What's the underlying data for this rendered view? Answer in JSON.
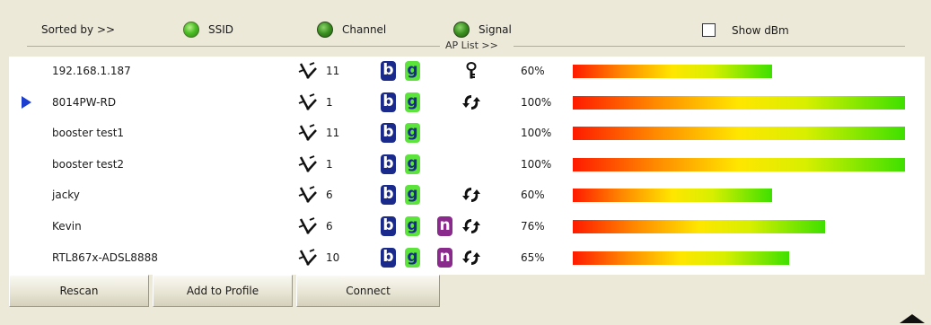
{
  "sortbar": {
    "sorted_by": "Sorted by >>",
    "ssid": "SSID",
    "channel": "Channel",
    "signal": "Signal",
    "show_dbm": "Show dBm",
    "ap_list": "AP List >>"
  },
  "rows": [
    {
      "ssid": "192.168.1.187",
      "channel": "11",
      "b": "b",
      "g": "g",
      "n": "",
      "security": "key-icon",
      "signal": "60%",
      "signal_value": 0.6
    },
    {
      "ssid": "8014PW-RD",
      "channel": "1",
      "b": "b",
      "g": "g",
      "n": "",
      "security": "wps-icon",
      "signal": "100%",
      "signal_value": 1.0,
      "selected": true
    },
    {
      "ssid": "booster test1",
      "channel": "11",
      "b": "b",
      "g": "g",
      "n": "",
      "security": "",
      "signal": "100%",
      "signal_value": 1.0
    },
    {
      "ssid": "booster test2",
      "channel": "1",
      "b": "b",
      "g": "g",
      "n": "",
      "security": "",
      "signal": "100%",
      "signal_value": 1.0
    },
    {
      "ssid": "jacky",
      "channel": "6",
      "b": "b",
      "g": "g",
      "n": "",
      "security": "wps-icon",
      "signal": "60%",
      "signal_value": 0.6
    },
    {
      "ssid": "Kevin",
      "channel": "6",
      "b": "b",
      "g": "g",
      "n": "n",
      "security": "wps-icon",
      "signal": "76%",
      "signal_value": 0.76
    },
    {
      "ssid": "RTL867x-ADSL8888",
      "channel": "10",
      "b": "b",
      "g": "g",
      "n": "n",
      "security": "wps-icon",
      "signal": "65%",
      "signal_value": 0.65
    }
  ],
  "buttons": {
    "rescan": "Rescan",
    "add_to_profile": "Add to Profile",
    "connect": "Connect"
  }
}
